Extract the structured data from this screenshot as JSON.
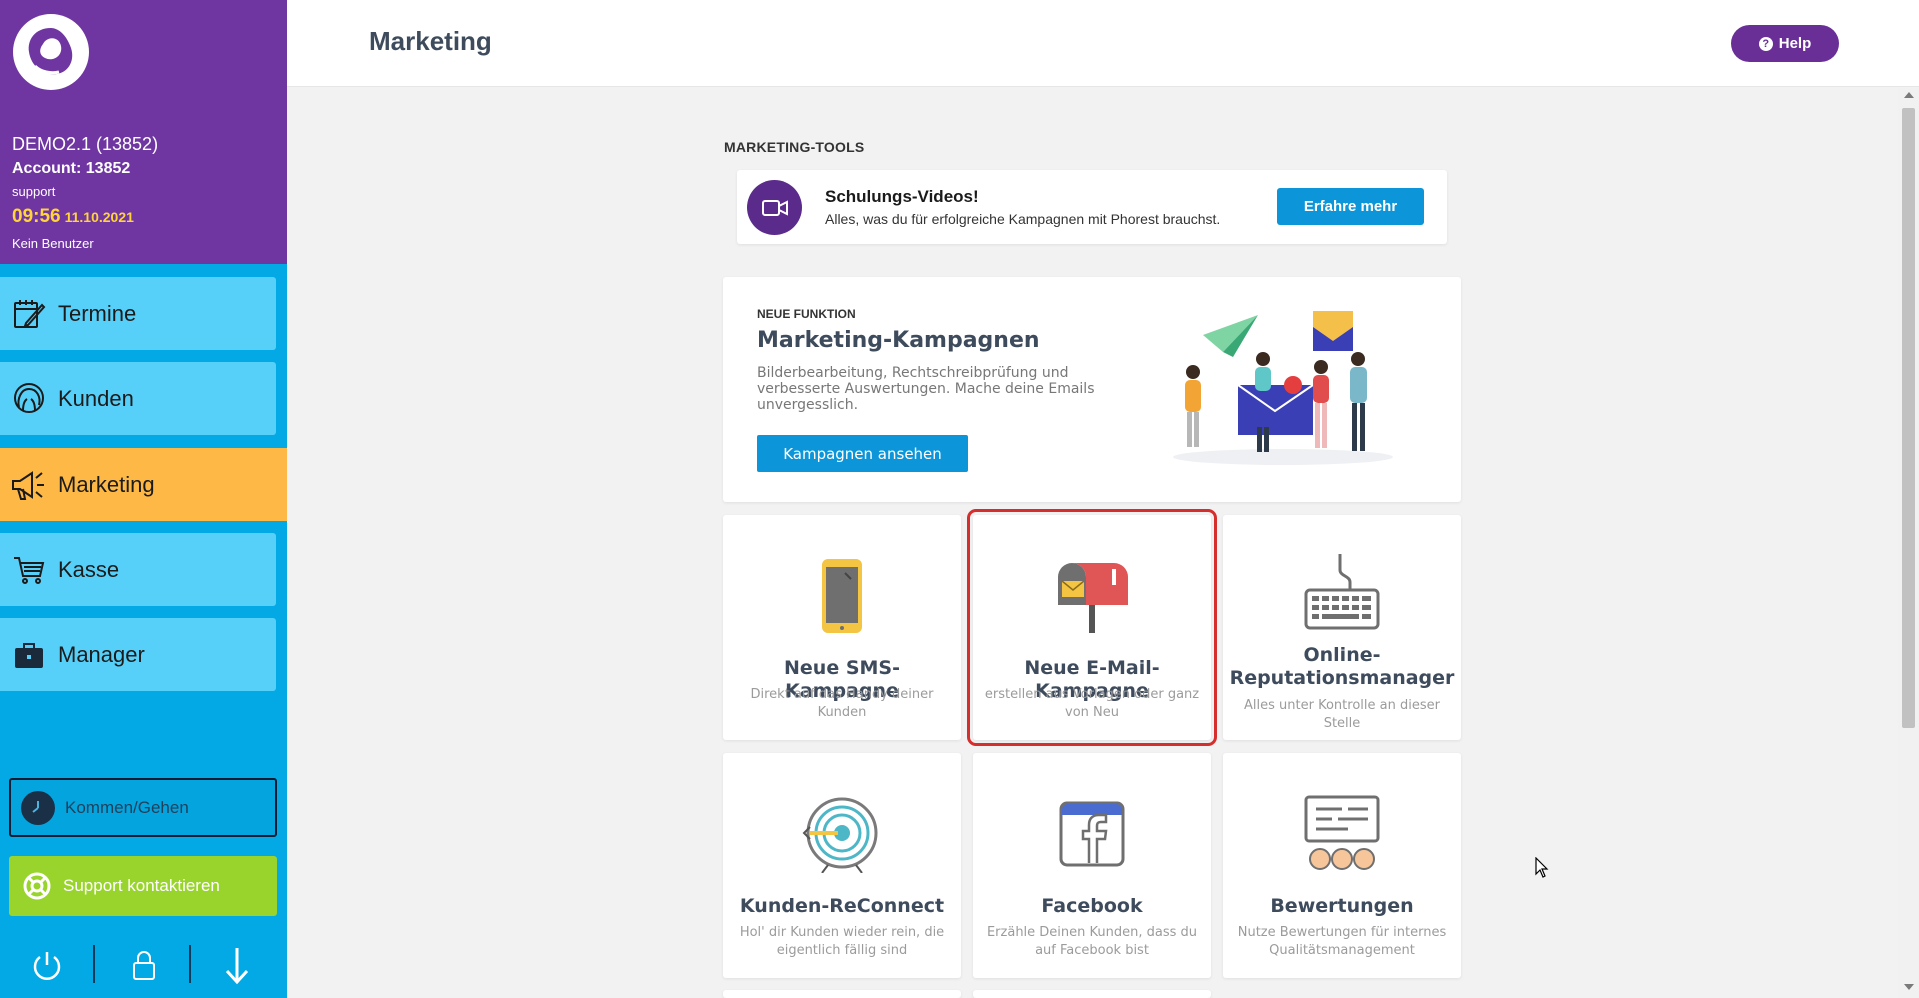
{
  "sidebar": {
    "company": "DEMO2.1 (13852)",
    "account": "Account: 13852",
    "role": "support",
    "time": "09:56",
    "date": "11.10.2021",
    "user": "Kein Benutzer",
    "nav": [
      {
        "label": "Termine",
        "icon": "calendar-edit-icon"
      },
      {
        "label": "Kunden",
        "icon": "customer-head-icon"
      },
      {
        "label": "Marketing",
        "icon": "megaphone-icon"
      },
      {
        "label": "Kasse",
        "icon": "cart-icon"
      },
      {
        "label": "Manager",
        "icon": "briefcase-icon"
      }
    ],
    "active_nav": "Marketing",
    "kommen_label": "Kommen/Gehen",
    "support_label": "Support kontaktieren"
  },
  "header": {
    "title": "Marketing",
    "help_label": "Help"
  },
  "main": {
    "section_heading": "MARKETING-TOOLS",
    "promo": {
      "title": "Schulungs-Videos!",
      "description": "Alles, was du für erfolgreiche Kampagnen mit Phorest brauchst.",
      "button": "Erfahre mehr"
    },
    "feature": {
      "tag": "NEUE FUNKTION",
      "title": "Marketing-Kampagnen",
      "description": "Bilderbearbeitung, Rechtschreibprüfung und verbesserte Auswertungen. Mache deine Emails unvergesslich.",
      "button": "Kampagnen ansehen"
    },
    "tiles": [
      {
        "title": "Neue SMS-Kampagne",
        "description": "Direkt auf das Handy deiner Kunden",
        "icon": "phone-icon"
      },
      {
        "title": "Neue E-Mail-Kampagne",
        "description": "erstellen aus Vorlagen oder ganz von Neu",
        "icon": "mailbox-icon"
      },
      {
        "title": "Online-Reputationsmanager",
        "description": "Alles unter Kontrolle an dieser Stelle",
        "icon": "keyboard-icon"
      },
      {
        "title": "Kunden-ReConnect",
        "description": "Hol' dir Kunden wieder rein, die eigentlich fällig sind",
        "icon": "target-icon"
      },
      {
        "title": "Facebook",
        "description": "Erzähle Deinen Kunden, dass du auf Facebook bist",
        "icon": "facebook-icon"
      },
      {
        "title": "Bewertungen",
        "description": "Nutze Bewertungen für internes Qualitätsmanagement",
        "icon": "reviews-icon"
      }
    ]
  },
  "colors": {
    "sidebar_top": "#6f35a1",
    "sidebar": "#03a9e4",
    "nav_item": "#57d0f9",
    "nav_active": "#fdb845",
    "primary_button": "#0c96d9",
    "help_button": "#6a2f97",
    "support_button": "#98d42b",
    "selection_outline": "#d62d2d"
  }
}
